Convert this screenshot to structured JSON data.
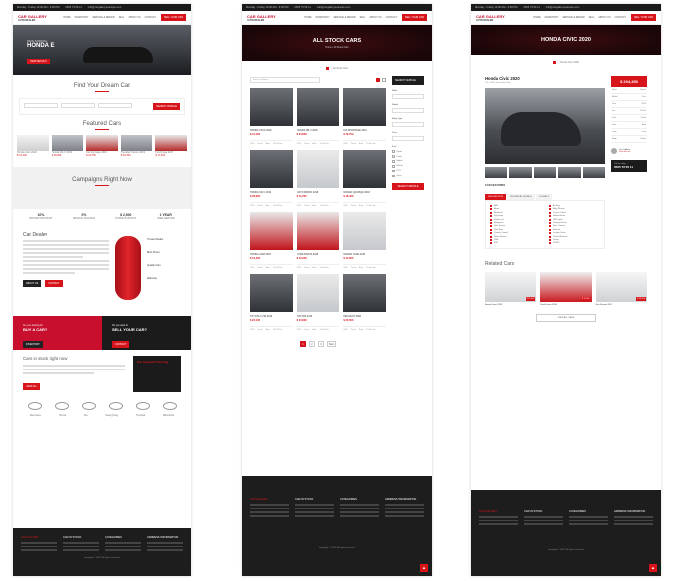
{
  "shared": {
    "topbar": {
      "hours": "Monday - Friday 10:00 AM - 6:00 PM",
      "phone": "0505 73 50 11",
      "email": "info@cargalleryexample.com"
    },
    "logo": {
      "name": "CAR GALLERY",
      "tagline": "AUTO DEALER"
    },
    "nav_links": [
      "HOME",
      "INVENTORY",
      "SERVICE & REPAIR",
      "SELL",
      "ABOUT US",
      "CONTACT"
    ],
    "cta": "SELL YOUR CAR",
    "footer": {
      "cols": [
        "CAR GALLERY",
        "CAR IN STOCK",
        "CATEGORIES",
        "ADDRESS INFORMATION"
      ],
      "copyright": "Copyright © 2020. All rights reserved."
    },
    "scroll_top_icon": "▲"
  },
  "home": {
    "hero": {
      "kicker": "NEW ARRIVAL",
      "model": "HONDA E",
      "button": "VIEW DETAILS"
    },
    "find_title": "Find Your Dream Car",
    "search_button": "SEARCH VEHICLE",
    "featured_title": "Featured Cars",
    "featured_cars": [
      {
        "name": "Honda Civic 2020",
        "price": "$ 21,400"
      },
      {
        "name": "Honda CR-V 2019",
        "price": "$ 28,900"
      },
      {
        "name": "Kia Sportage 2018",
        "price": "$ 19,750"
      },
      {
        "name": "Hyundai Tucson 2019",
        "price": "$ 24,300"
      },
      {
        "name": "Ford Kuga 2017",
        "price": "$ 17,600"
      }
    ],
    "campaigns_title": "Campaigns Right Now",
    "campaigns": [
      {
        "label": "WINTER DISCOUNT",
        "value": "10%"
      },
      {
        "label": "SPECIAL FINANCE",
        "value": "0%"
      },
      {
        "label": "TRADE IN BONUS",
        "value": "$ 2,000"
      },
      {
        "label": "FREE SERVICE",
        "value": "1 YEAR"
      }
    ],
    "dealer_title": "Car Dealer",
    "dealer_features": [
      "Trusted Dealer",
      "Best Prices",
      "Quality Cars",
      "Warranty"
    ],
    "dealer_buttons": [
      "ABOUT US",
      "CONTACT"
    ],
    "banner_buy": {
      "kicker": "Are you looking for",
      "title": "BUY A CAR?",
      "button": "INVENTORY"
    },
    "banner_sell": {
      "kicker": "Do you want to",
      "title": "SELL YOUR CAR?",
      "button": "CONTACT"
    },
    "stock_title": "Cars in stock right now",
    "stock_button": "VIEW ALL",
    "ad_box_title": "Get Special Financing",
    "brand_names": [
      "Mercedes",
      "Honda",
      "Kia",
      "SsangYong",
      "Hyundai",
      "Mitsubishi"
    ]
  },
  "stock": {
    "title": "ALL STOCK CARS",
    "subtitle": "Home / All Stock Cars",
    "crumb": "All Stock Cars",
    "sort_placeholder": "Sort by: Newest",
    "sidebar_title": "SEARCH VEHICLE",
    "filters": [
      "Make",
      "Model",
      "Body Type",
      "Price",
      "Fuel"
    ],
    "fuel_options": [
      "Diesel",
      "Petrol",
      "Hybrid",
      "Electric",
      "LPG",
      "Other"
    ],
    "cars": [
      {
        "name": "HONDA CIVIC 2020",
        "price": "$ 21,400",
        "style": "dark"
      },
      {
        "name": "HONDA HR-V 2020",
        "price": "$ 24,800",
        "style": "dark"
      },
      {
        "name": "KIA SPORTAGE 2019",
        "price": "$ 19,750",
        "style": "dark"
      },
      {
        "name": "HONDA CR-V 2019",
        "price": "$ 28,900",
        "style": "dark"
      },
      {
        "name": "FIAT FIORINO 2018",
        "price": "$ 11,200",
        "style": "light"
      },
      {
        "name": "NISSAN QASHQAI 2018",
        "price": "$ 18,400",
        "style": "dark"
      },
      {
        "name": "HONDA JAZZ 2019",
        "price": "$ 15,300",
        "style": "red"
      },
      {
        "name": "FORD FIESTA 2018",
        "price": "$ 12,900",
        "style": "red"
      },
      {
        "name": "NISSAN JUKE 2018",
        "price": "$ 14,600",
        "style": "light"
      },
      {
        "name": "TOYOTA C-HR 2019",
        "price": "$ 22,100",
        "style": "dark"
      },
      {
        "name": "FIAT 500 2019",
        "price": "$ 10,800",
        "style": "light"
      },
      {
        "name": "PEUGEOT 3008",
        "price": "$ 23,500",
        "style": "dark"
      }
    ],
    "spec_labels": [
      "2020",
      "Petrol",
      "Auto",
      "15.000 km"
    ],
    "pages": [
      "1",
      "2",
      "3"
    ],
    "next": "Next"
  },
  "detail": {
    "title": "HONDA CIVIC 2020",
    "crumb": "Honda Civic 2020",
    "car_title": "Honda Civic 2020",
    "car_sub": "1.6 i-VTEC Executive Plus",
    "price": "$ 204,450",
    "specs": [
      {
        "k": "Make",
        "v": "Honda"
      },
      {
        "k": "Model",
        "v": "Civic"
      },
      {
        "k": "Year",
        "v": "2020"
      },
      {
        "k": "Km",
        "v": "15.000"
      },
      {
        "k": "Fuel",
        "v": "Petrol"
      },
      {
        "k": "Gear",
        "v": "Auto"
      },
      {
        "k": "Color",
        "v": "Grey"
      },
      {
        "k": "Body",
        "v": "Sedan"
      }
    ],
    "seller_name": "Car Gallery",
    "seller_link": "View all cars",
    "phone_label": "Call us today",
    "phone": "0505 73 50 11",
    "tabs": [
      "DESCRIPTION",
      "TECHNICAL DETAILS",
      "CONTACT"
    ],
    "features_title": "CAR FEATURES",
    "features": [
      "ABS",
      "Air Bag",
      "Alarm",
      "Alloy Wheels",
      "Bluetooth",
      "Cruise Control",
      "Fog Lamp",
      "Heated Seats",
      "Keyless Go",
      "LED Lights",
      "Navigation",
      "Parking Sensor",
      "Rain Sensor",
      "Rear Camera",
      "Start Stop",
      "Sunroof",
      "Climate Control",
      "Leather Seats",
      "Power Mirrors",
      "Power Windows",
      "USB",
      "Xenon",
      "ESP",
      "ISOFIX"
    ],
    "related_title": "Related Cars",
    "related": [
      {
        "name": "Honda Jazz 2019",
        "badge": "$ 15,300"
      },
      {
        "name": "Ford Fiesta 2018",
        "badge": "$ 12,900"
      },
      {
        "name": "Fiat Ducato 2017",
        "badge": "$ 19,200"
      }
    ],
    "view_all": "VIEW ALL CARS"
  }
}
